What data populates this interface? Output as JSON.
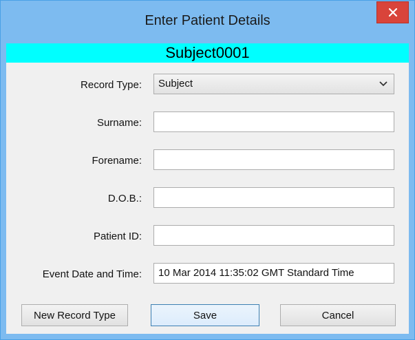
{
  "window": {
    "title": "Enter Patient Details"
  },
  "subject": {
    "name": "Subject0001",
    "bar_color": "#00ffff"
  },
  "form": {
    "record_type": {
      "label": "Record Type:",
      "value": "Subject"
    },
    "surname": {
      "label": "Surname:",
      "value": ""
    },
    "forename": {
      "label": "Forename:",
      "value": ""
    },
    "dob": {
      "label": "D.O.B.:",
      "value": ""
    },
    "patient_id": {
      "label": "Patient ID:",
      "value": ""
    },
    "event_datetime": {
      "label": "Event Date and Time:",
      "value": "10 Mar 2014 11:35:02 GMT Standard Time"
    }
  },
  "buttons": {
    "new_record_type": "New Record Type",
    "save": "Save",
    "cancel": "Cancel"
  },
  "icons": {
    "close": "close-icon",
    "dropdown": "chevron-down-icon"
  }
}
